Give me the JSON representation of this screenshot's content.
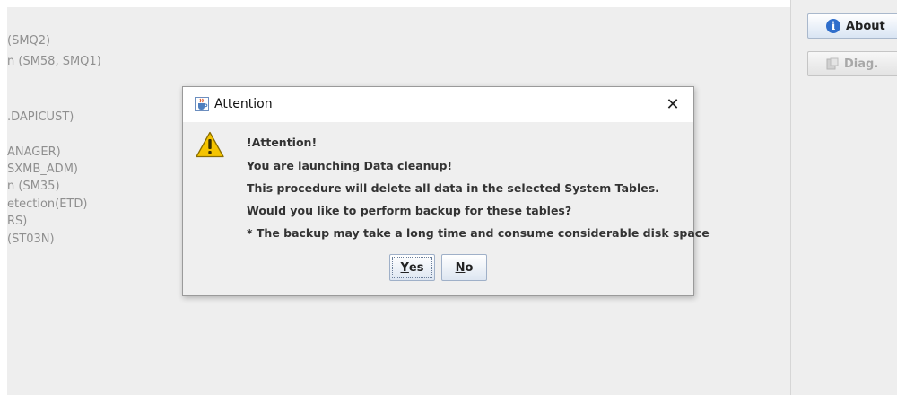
{
  "background": {
    "items": [
      "(SMQ2)",
      "n (SM58, SMQ1)",
      ".DAPICUST)",
      "ANAGER)",
      "SXMB_ADM)",
      "n (SM35)",
      "etection(ETD)",
      "RS)",
      "(ST03N)"
    ]
  },
  "sidebar": {
    "about_label": "About",
    "about_icon": "info-icon",
    "diag_label": "Diag.",
    "diag_icon": "diagnostics-icon"
  },
  "dialog": {
    "title": "Attention",
    "title_icon": "java-cup-icon",
    "close_symbol": "✕",
    "icon": "warning-icon",
    "messages": [
      "!Attention!",
      "You are launching Data cleanup!",
      "This procedure will delete all data in the selected System Tables.",
      "Would you like to perform backup for these tables?",
      "* The backup may take a long time and consume considerable disk space"
    ],
    "yes_mnemonic": "Y",
    "yes_rest": "es",
    "no_mnemonic": "N",
    "no_rest": "o"
  },
  "colors": {
    "accent": "#2f6ecb",
    "warning": "#f2c200"
  }
}
